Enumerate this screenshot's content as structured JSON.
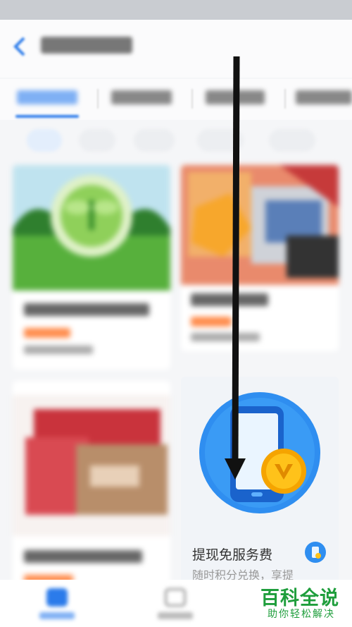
{
  "header": {
    "title": ""
  },
  "tabs": [
    {
      "label": "",
      "active": true
    },
    {
      "label": ""
    },
    {
      "label": ""
    },
    {
      "label": ""
    }
  ],
  "filters": [
    {
      "label": "",
      "active": true
    },
    {
      "label": ""
    },
    {
      "label": ""
    },
    {
      "label": ""
    },
    {
      "label": ""
    }
  ],
  "cards": [
    {
      "title": "",
      "price": "",
      "sub": ""
    },
    {
      "title": "",
      "price": "",
      "sub": ""
    },
    {
      "title": "",
      "price": "",
      "sub": ""
    },
    {
      "title": "提现免服务费",
      "desc": "随时积分兑换，享提"
    }
  ],
  "watermark": {
    "title": "百科全说",
    "subtitle": "助你轻松解决"
  },
  "colors": {
    "accent": "#2b7bea",
    "price": "#ff7a2e",
    "watermark": "#1f9e3c"
  }
}
